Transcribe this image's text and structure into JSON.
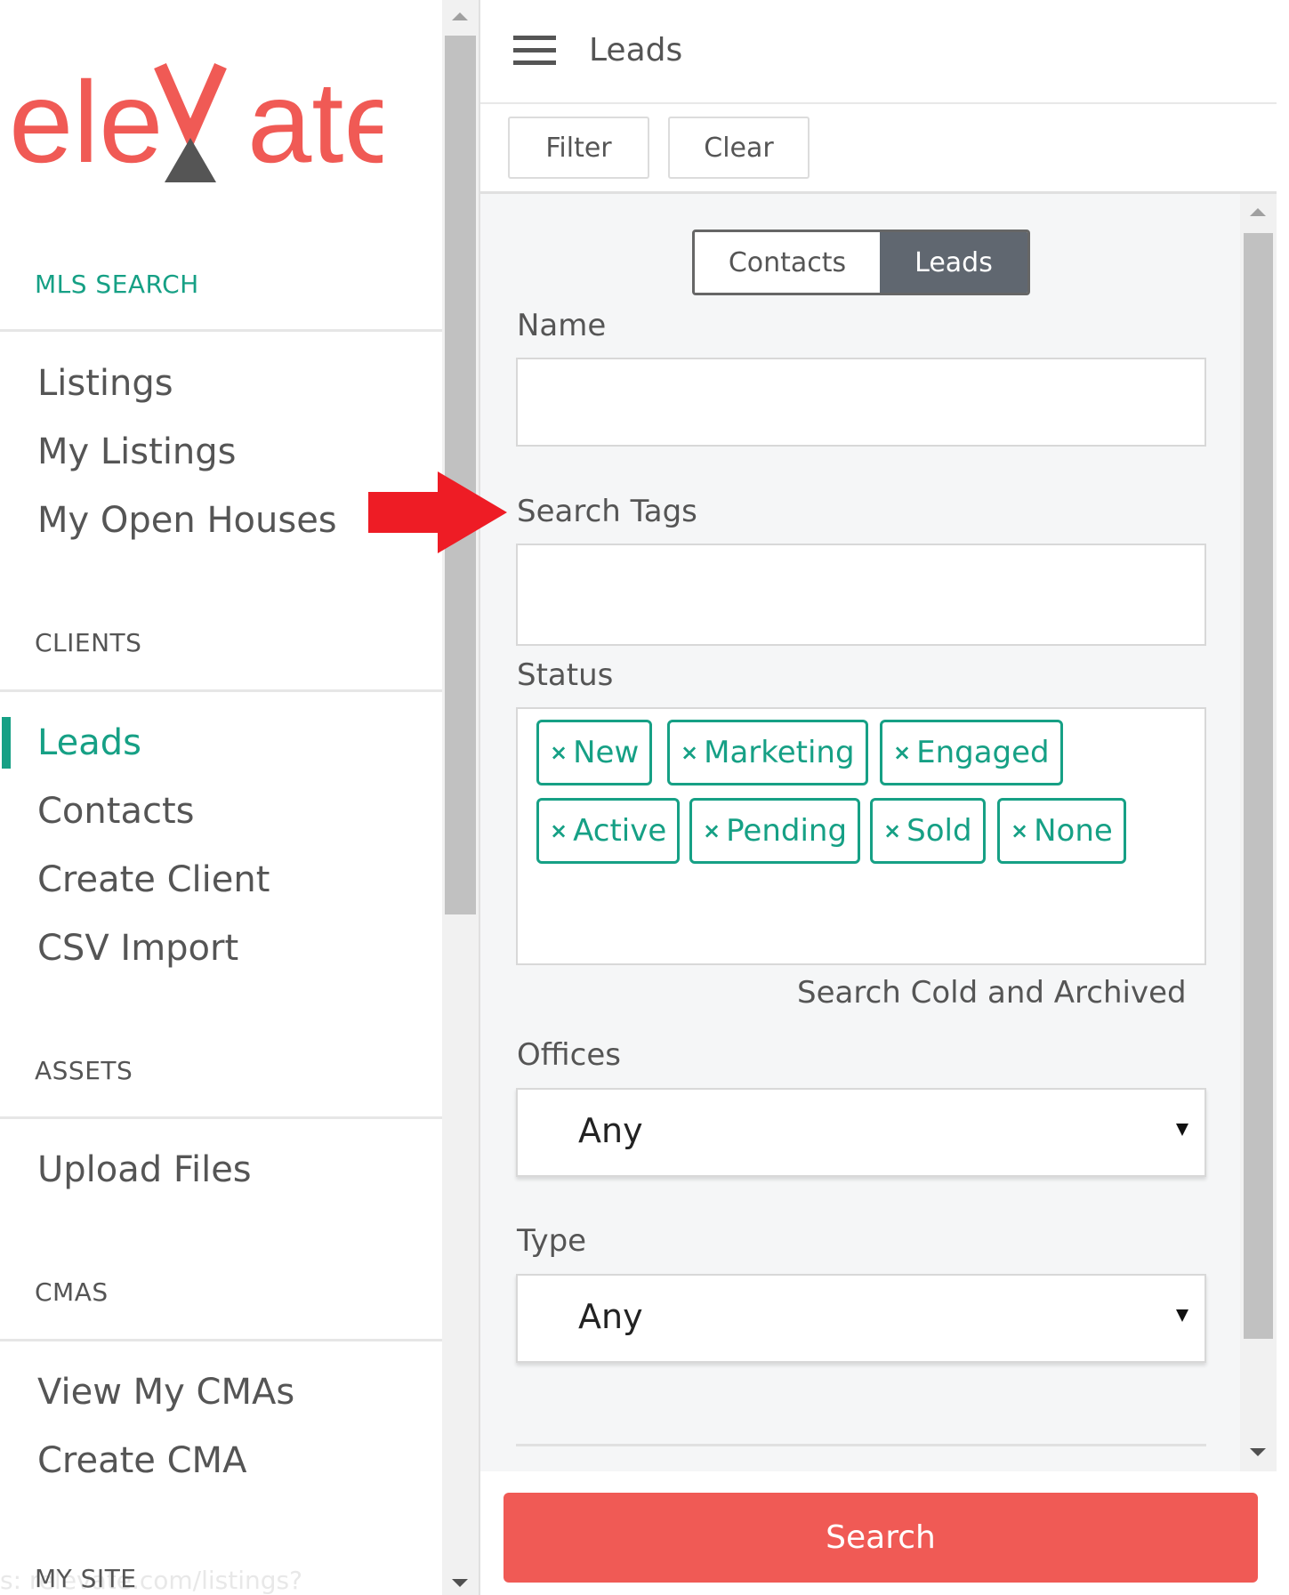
{
  "sidebar": {
    "logo_text": "eleVate",
    "sections": [
      {
        "heading": "MLS SEARCH",
        "items": [
          "Listings",
          "My Listings",
          "My Open Houses"
        ]
      },
      {
        "heading": "CLIENTS",
        "items": [
          "Leads",
          "Contacts",
          "Create Client",
          "CSV Import"
        ]
      },
      {
        "heading": "ASSETS",
        "items": [
          "Upload Files"
        ]
      },
      {
        "heading": "CMAS",
        "items": [
          "View My CMAs",
          "Create CMA"
        ]
      },
      {
        "heading": "MY SITE",
        "items": []
      }
    ],
    "active_item": "Leads",
    "status_url": "s: relevate.com/listings?"
  },
  "header": {
    "title": "Leads"
  },
  "toolbar": {
    "filter_label": "Filter",
    "clear_label": "Clear"
  },
  "filter": {
    "toggle": {
      "options": [
        "Contacts",
        "Leads"
      ],
      "selected": "Leads"
    },
    "name_label": "Name",
    "name_value": "",
    "search_tags_label": "Search Tags",
    "search_tags_value": "",
    "status_label": "Status",
    "status_tags": [
      "New",
      "Marketing",
      "Engaged",
      "Active",
      "Pending",
      "Sold",
      "None"
    ],
    "tag_remove_symbol": "×",
    "cold_archived_label": "Search Cold and Archived",
    "offices_label": "Offices",
    "offices_value": "Any",
    "type_label": "Type",
    "type_value": "Any"
  },
  "search_button_label": "Search",
  "colors": {
    "accent_teal": "#16a085",
    "search_red": "#f05a55",
    "toggle_dark": "#606770",
    "logo_red": "#f05a55",
    "logo_dark": "#555555",
    "annotation_arrow": "#ee1c25"
  },
  "icons": [
    "hamburger-menu-icon",
    "close-icon",
    "dropdown-caret-icon",
    "scroll-up-arrow-icon",
    "scroll-down-arrow-icon",
    "annotation-red-arrow"
  ]
}
